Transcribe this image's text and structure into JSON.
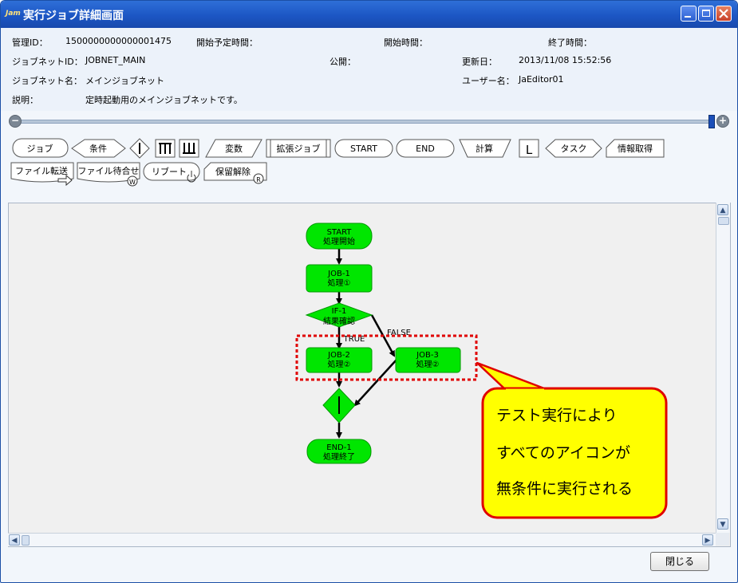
{
  "window": {
    "logo": "Jam",
    "title": "実行ジョブ詳細画面"
  },
  "info": {
    "manage_id_label": "管理ID：",
    "manage_id_value": "1500000000000001475",
    "scheduled_start_label": "開始予定時間：",
    "start_time_label": "開始時間：",
    "end_time_label": "終了時間：",
    "jobnet_id_label": "ジョブネットID：",
    "jobnet_id_value": "JOBNET_MAIN",
    "public_label": "公開：",
    "updated_label": "更新日：",
    "updated_value": "2013/11/08 15:52:56",
    "jobnet_name_label": "ジョブネット名：",
    "jobnet_name_value": "メインジョブネット",
    "user_label": "ユーザー名：",
    "user_value": "JaEditor01",
    "description_label": "説明：",
    "description_value": "定時起動用のメインジョブネットです。"
  },
  "palette": {
    "job": "ジョブ",
    "condition": "条件",
    "variable": "変数",
    "extended_job": "拡張ジョブ",
    "start": "START",
    "end": "END",
    "calc": "計算",
    "task": "タスク",
    "info_get": "情報取得",
    "file_transfer": "ファイル転送",
    "file_wait": "ファイル待合せ",
    "reboot": "リブート",
    "hold_release": "保留解除",
    "icon_w": "W",
    "icon_r": "R",
    "icon_l": "L"
  },
  "flow": {
    "start_line1": "START",
    "start_line2": "処理開始",
    "job1_line1": "JOB-1",
    "job1_line2": "処理①",
    "if1_line1": "IF-1",
    "if1_line2": "結果確認",
    "true_label": "TRUE",
    "false_label": "FALSE",
    "job2_line1": "JOB-2",
    "job2_line2": "処理②",
    "job3_line1": "JOB-3",
    "job3_line2": "処理②",
    "end1_line1": "END-1",
    "end1_line2": "処理終了"
  },
  "callout": {
    "line1": "テスト実行により",
    "line2": "すべてのアイコンが",
    "line3": "無条件に実行される"
  },
  "footer": {
    "close_label": "閉じる"
  },
  "colors": {
    "node_fill": "#00e600",
    "highlight": "#e00000",
    "callout_fill": "#ffff00"
  }
}
